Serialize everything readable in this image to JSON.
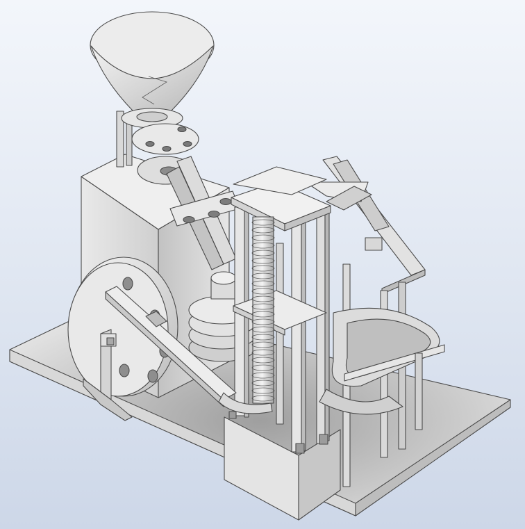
{
  "view": {
    "background_top": "#f3f6fb",
    "background_bottom": "#cdd7e8",
    "part_face_light": "#f4f4f4",
    "part_face_mid": "#d9d9d9",
    "part_face_dark": "#a9a9a9",
    "edge_color": "#4a4a4a"
  },
  "components": [
    "hopper-funnel",
    "feed-disc",
    "base-plate",
    "main-block",
    "flywheel",
    "inclined-chute",
    "lift-tower",
    "helical-screw",
    "track-ramp",
    "return-track"
  ]
}
